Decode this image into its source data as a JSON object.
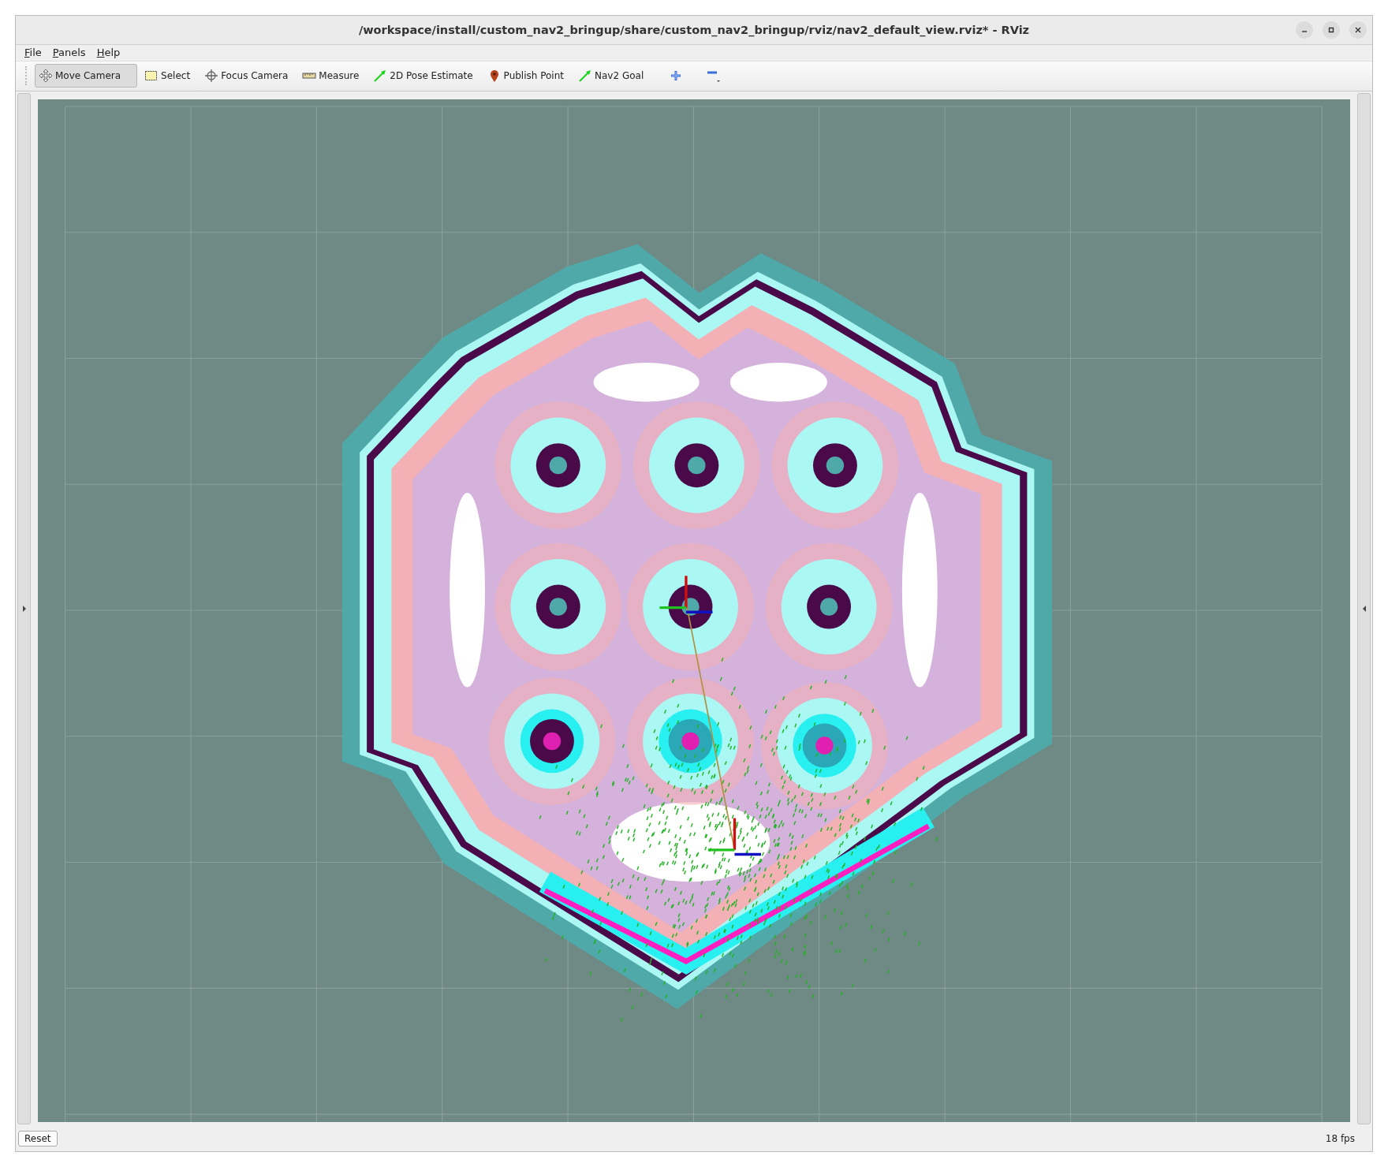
{
  "window": {
    "title": "/workspace/install/custom_nav2_bringup/share/custom_nav2_bringup/rviz/nav2_default_view.rviz* - RViz"
  },
  "menu": [
    "File",
    "Panels",
    "Help"
  ],
  "toolbar": [
    {
      "label": "Move Camera",
      "selected": true
    },
    {
      "label": "Select",
      "selected": false
    },
    {
      "label": "Focus Camera",
      "selected": false
    },
    {
      "label": "Measure",
      "selected": false
    },
    {
      "label": "2D Pose Estimate",
      "selected": false
    },
    {
      "label": "Publish Point",
      "selected": false
    },
    {
      "label": "Nav2 Goal",
      "selected": false
    }
  ],
  "status_bar": {
    "button": "Reset",
    "fps": "18 fps"
  }
}
